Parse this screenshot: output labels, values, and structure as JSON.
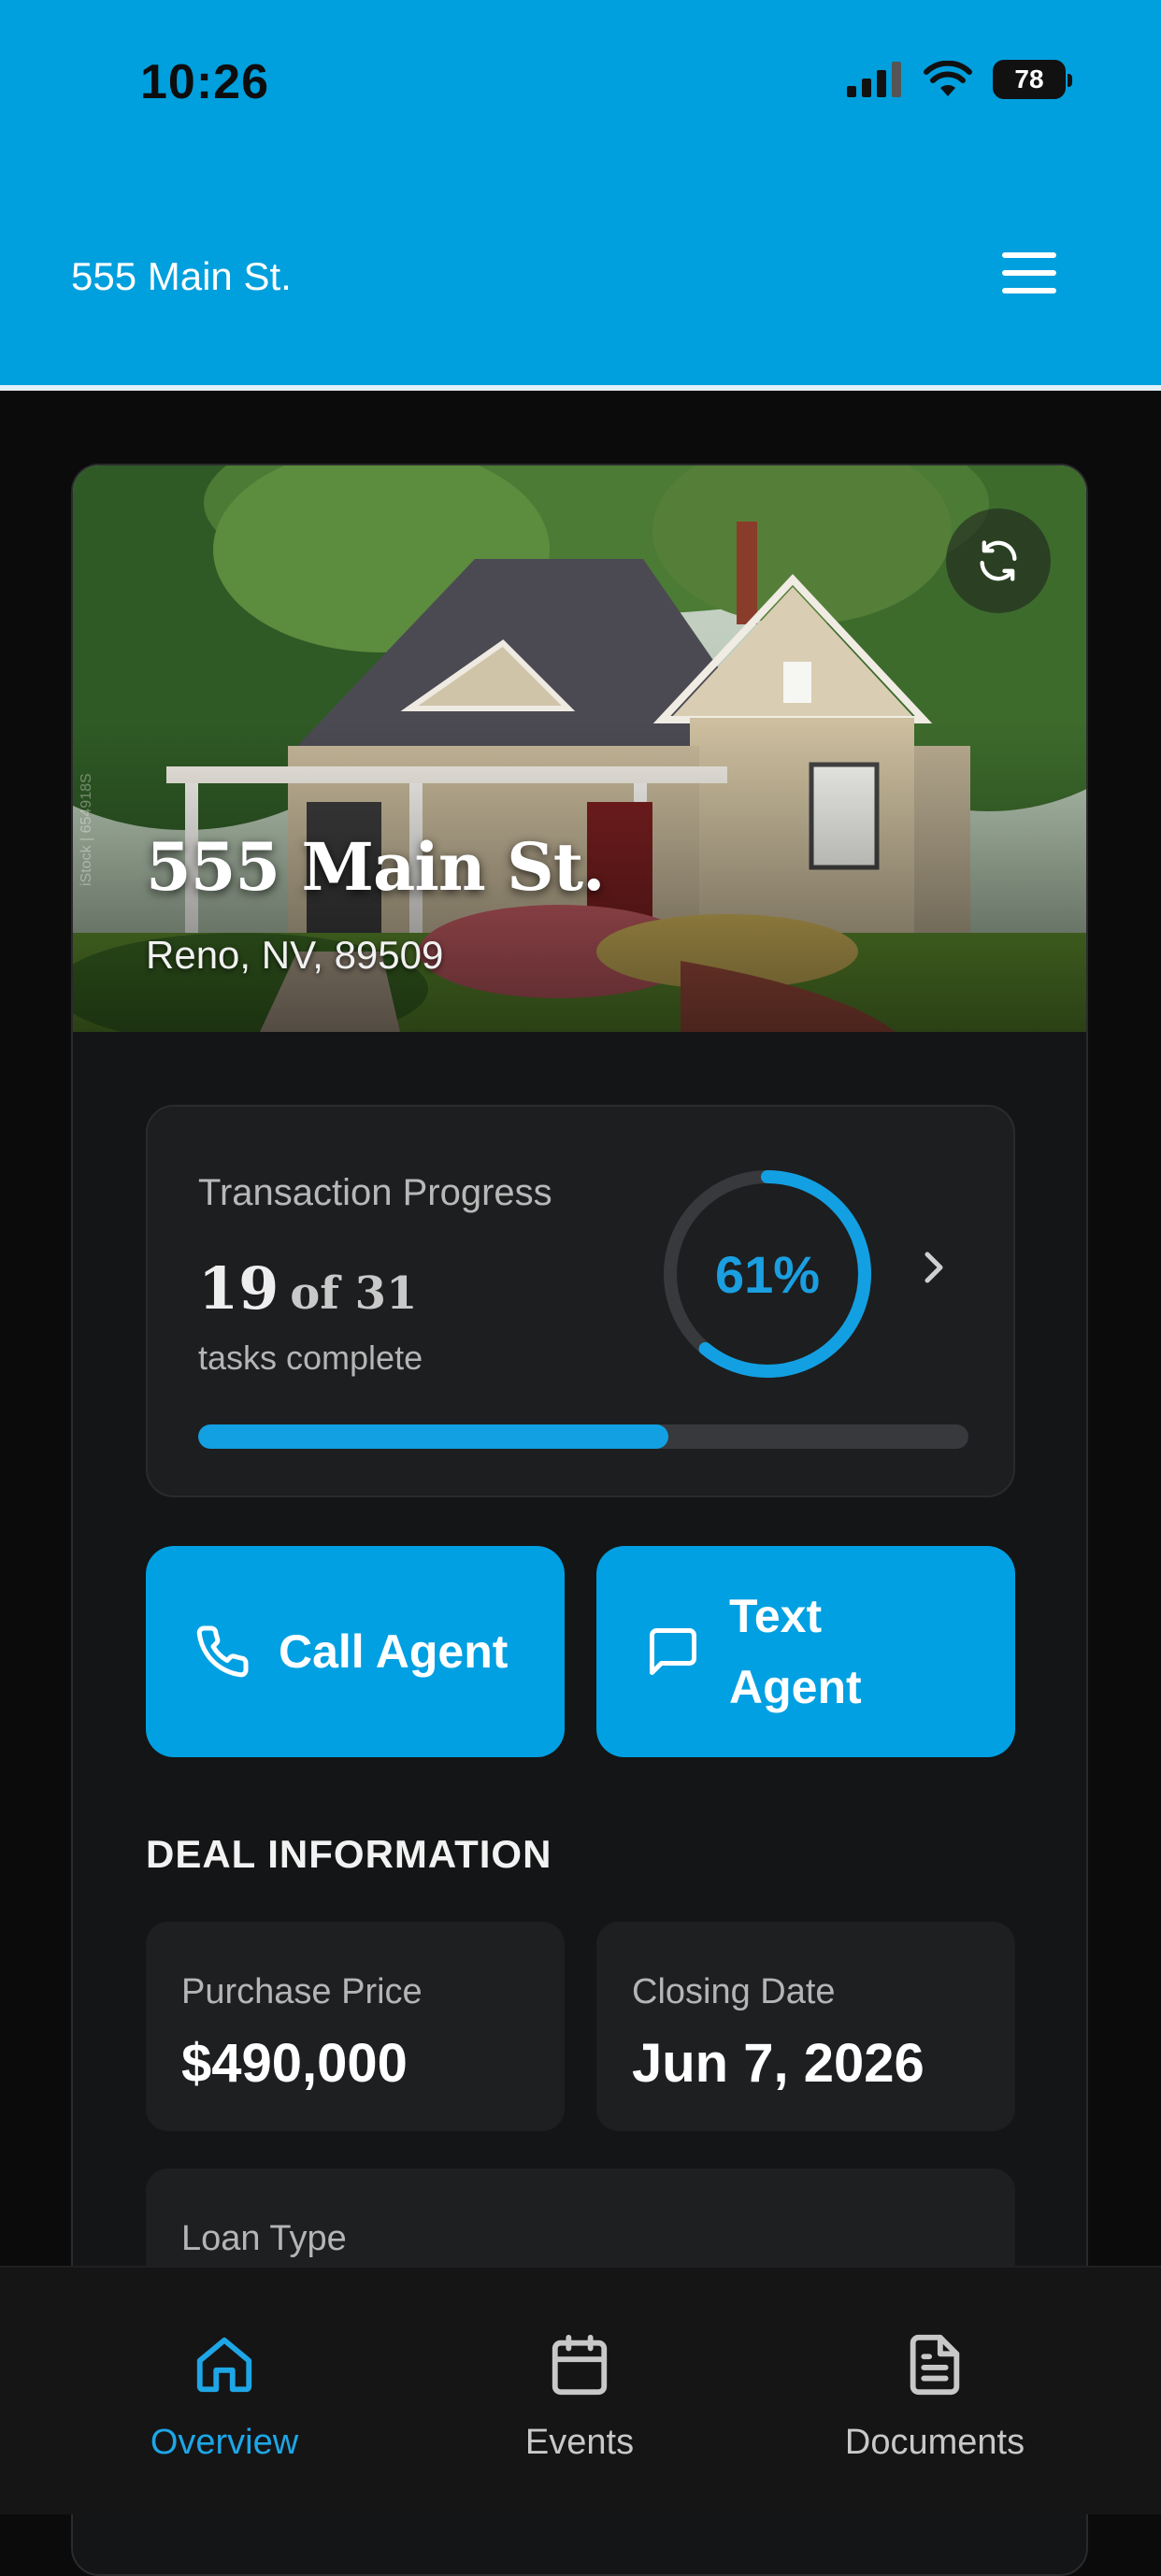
{
  "status": {
    "time": "10:26",
    "battery": "78"
  },
  "header": {
    "title": "555 Main St."
  },
  "hero": {
    "title": "555 Main St.",
    "address": "Reno, NV, 89509",
    "watermark": "iStock | 654918S"
  },
  "progress": {
    "label": "Transaction Progress",
    "done": "19",
    "of_total": "of 31",
    "sub": "tasks complete",
    "percent_label": "61%",
    "percent": 61
  },
  "actions": {
    "call": "Call Agent",
    "text_line1": "Text",
    "text_line2": "Agent"
  },
  "deal": {
    "section_title": "DEAL INFORMATION",
    "purchase_price_label": "Purchase Price",
    "purchase_price": "$490,000",
    "closing_date_label": "Closing Date",
    "closing_date": "Jun 7, 2026",
    "loan_type_label": "Loan Type"
  },
  "tabs": [
    {
      "label": "Overview",
      "icon": "home-icon",
      "active": true
    },
    {
      "label": "Events",
      "icon": "calendar-icon",
      "active": false
    },
    {
      "label": "Documents",
      "icon": "document-icon",
      "active": false
    }
  ],
  "colors": {
    "accent": "#00a0e2",
    "header": "#009fdd",
    "background": "#0b0b0c",
    "card": "#1d1e20"
  }
}
